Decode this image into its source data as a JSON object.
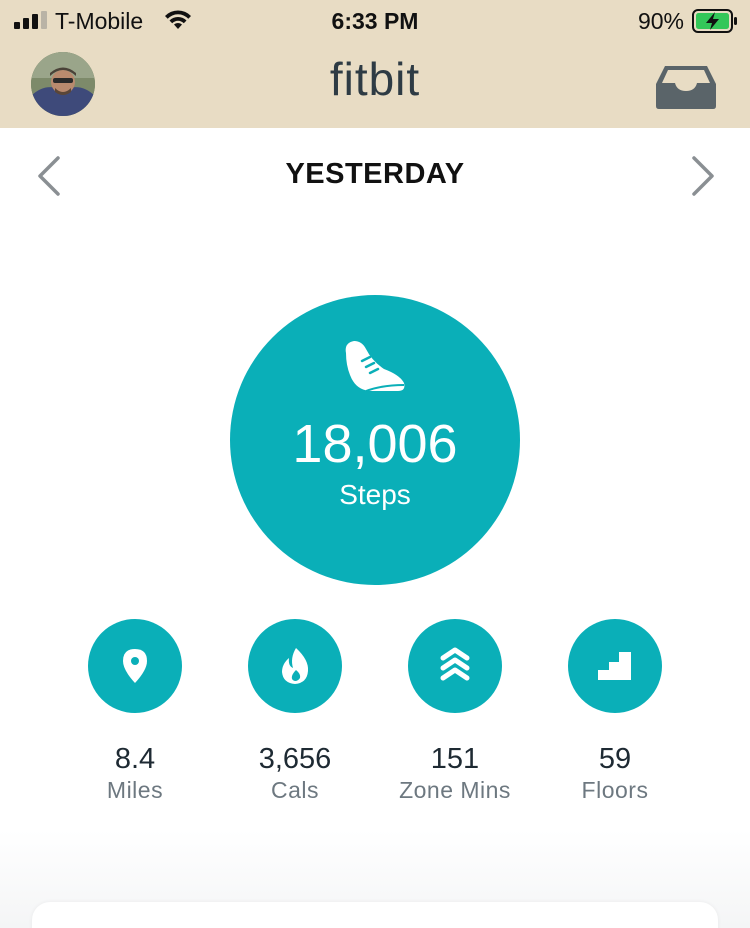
{
  "status_bar": {
    "carrier": "T-Mobile",
    "time": "6:33 PM",
    "battery_percent": "90%"
  },
  "header": {
    "brand": "fitbit"
  },
  "date_nav": {
    "label": "YESTERDAY"
  },
  "steps": {
    "value": "18,006",
    "label": "Steps"
  },
  "stats": [
    {
      "value": "8.4",
      "label": "Miles",
      "icon": "location-pin-icon"
    },
    {
      "value": "3,656",
      "label": "Cals",
      "icon": "flame-icon"
    },
    {
      "value": "151",
      "label": "Zone Mins",
      "icon": "chevrons-up-icon"
    },
    {
      "value": "59",
      "label": "Floors",
      "icon": "stairs-icon"
    }
  ],
  "colors": {
    "header_bg": "#e8dcc4",
    "accent": "#0aafb8",
    "battery_green": "#34c759"
  }
}
